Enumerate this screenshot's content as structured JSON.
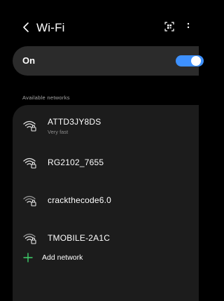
{
  "header": {
    "title": "Wi-Fi",
    "back_icon": "chevron-left-icon",
    "qr_icon": "qr-scan-icon",
    "more_icon": "more-vertical-icon"
  },
  "toggle": {
    "label": "On",
    "state": "on",
    "accent_color": "#3e91ff"
  },
  "available": {
    "section_label": "Available networks",
    "networks": [
      {
        "name": "ATTD3JY8DS",
        "status": "Very fast",
        "secured": true,
        "icon": "wifi-lock-icon"
      },
      {
        "name": "RG2102_7655",
        "status": "",
        "secured": true,
        "icon": "wifi-lock-icon"
      },
      {
        "name": "crackthecode6.0",
        "status": "",
        "secured": true,
        "icon": "wifi-lock-icon"
      },
      {
        "name": "TMOBILE-2A1C",
        "status": "",
        "secured": true,
        "icon": "wifi-lock-icon"
      }
    ],
    "add_label": "Add network",
    "add_icon": "plus-icon",
    "add_color": "#3ed06b"
  }
}
